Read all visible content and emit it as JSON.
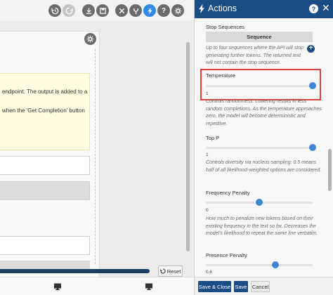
{
  "toolbar": {
    "icons": [
      "history-icon",
      "redo-icon",
      "download-icon",
      "save-icon",
      "tools-icon",
      "fork-icon",
      "actions-icon",
      "help-icon",
      "settings-icon"
    ],
    "help_glyph": "?"
  },
  "editor": {
    "note_line1": "endpoint. The output is added to a",
    "note_line2": "when the 'Get Completion' button",
    "reset_label": "Reset"
  },
  "actions": {
    "title": "Actions",
    "help_glyph": "?",
    "close_glyph": "✕",
    "stop_sequences": {
      "label": "Stop Sequences",
      "value": "Sequence",
      "add_glyph": "+",
      "help": "Up to four sequences where the API will stop generating further tokens. The returned text will not contain the stop sequence."
    },
    "temperature": {
      "label": "Temperature",
      "value": "1",
      "help": "Controls randomness: Lowering results in less random completions. As the temperature approaches zero, the model will become deterministic and repetitive.",
      "level": 1.0
    },
    "top_p": {
      "label": "Top P",
      "value": "1",
      "help": "Controls diversity via nucleus sampling: 0.5 means half of all likelihood-weighted options are considered.",
      "level": 1.0
    },
    "frequency_penalty": {
      "label": "Frequency Penalty",
      "value": "0",
      "help": "How much to penalize new tokens based on their existing frequency in the text so far. Decreases the model's likelihood to repeat the same line verbatim.",
      "level": 0.5
    },
    "presence_penalty": {
      "label": "Presence Penalty",
      "value": "0.6",
      "level": 0.65
    },
    "footer": {
      "save_close": "Save & Close",
      "save": "Save",
      "cancel": "Cancel"
    }
  },
  "colors": {
    "header": "#1b4d85",
    "accent": "#2f8be6",
    "highlight": "#e0413b",
    "slider_knob": "#3e87d6"
  }
}
